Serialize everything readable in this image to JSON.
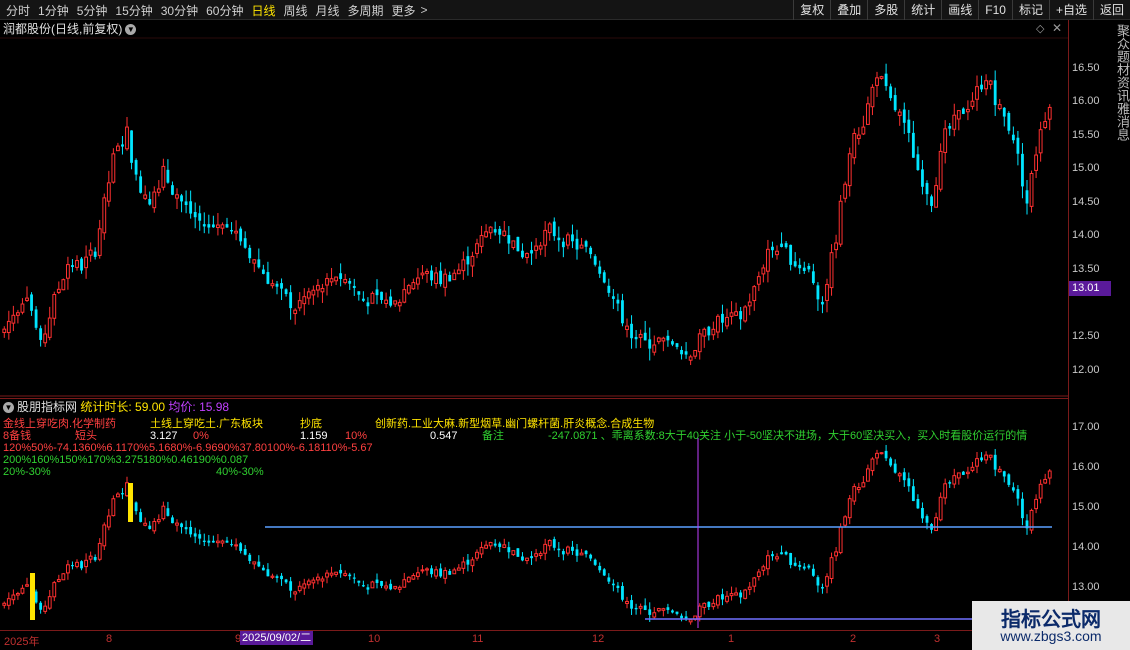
{
  "topbar": {
    "periods": [
      "分时",
      "1分钟",
      "5分钟",
      "15分钟",
      "30分钟",
      "60分钟",
      "日线",
      "周线",
      "月线",
      "多周期",
      "更多"
    ],
    "active_period": "日线",
    "tools": [
      "复权",
      "叠加",
      "多股",
      "统计",
      "画线",
      "F10",
      "标记",
      "+自选",
      "返回"
    ]
  },
  "main_chart": {
    "title": "润都股份(日线,前复权)",
    "y_ticks": [
      "16.50",
      "16.00",
      "15.50",
      "15.00",
      "14.50",
      "14.00",
      "13.50",
      "12.50",
      "12.00"
    ],
    "current_price": "13.01",
    "side_text": "聚众题材资讯雅消息"
  },
  "indicator": {
    "name": "股朋指标网",
    "duration_label": "统计时长: 59.00",
    "avg_label": "均价: 15.98",
    "y_ticks": [
      "17.00",
      "16.00",
      "15.00",
      "14.00",
      "13.00"
    ],
    "legend_rows": [
      [
        {
          "t": "金线上穿吃肉.化学制药",
          "c": "#ff4040"
        },
        {
          "t": "土线上穿吃土.广东板块",
          "c": "#ffe400"
        },
        {
          "t": "抄底",
          "c": "#ffe400"
        },
        {
          "t": "创新药.工业大麻.新型烟草.幽门螺杆菌.肝炎概念.合成生物",
          "c": "#ffe400"
        }
      ],
      [
        {
          "t": "8备钱",
          "c": "#ff4040"
        },
        {
          "t": "短头",
          "c": "#ff4040"
        },
        {
          "t": "3.127",
          "c": "#ffffff"
        },
        {
          "t": "0%",
          "c": "#ff4040"
        },
        {
          "t": "1.159",
          "c": "#ffffff"
        },
        {
          "t": "10%",
          "c": "#ff4040"
        },
        {
          "t": "0.547",
          "c": "#ffffff"
        },
        {
          "t": "备注",
          "c": "#30d030"
        },
        {
          "t": "-247.0871 、乖离系数:8大于40关注 小于-50坚决不进场，大于60坚决买入，买入时看股价运行的情",
          "c": "#30d030"
        }
      ],
      [
        {
          "t": "120%50%-74.1360%6.1170%5.1680%-6.9690%37.80100%-6.18110%-5.67",
          "c": "#ff4040"
        }
      ],
      [
        {
          "t": "200%160%150%170%3.275180%0.46190%0.087",
          "c": "#30d030"
        }
      ],
      [
        {
          "t": "20%-30%",
          "c": "#30d030"
        },
        {
          "t": "40%-30%",
          "c": "#30d030"
        }
      ]
    ]
  },
  "x_axis": {
    "labels": [
      "2025年",
      "8",
      "9",
      "10",
      "11",
      "12",
      "1",
      "2",
      "3"
    ],
    "cursor_date": "2025/09/02/二"
  },
  "watermark": {
    "line1": "指标公式网",
    "line2": "www.zbgs3.com"
  },
  "chart_data": {
    "type": "candlestick",
    "main_ylim": [
      11.8,
      16.9
    ],
    "indicator_ylim": [
      12.0,
      17.4
    ],
    "bull_color": "#ff3030",
    "bear_color": "#00e5ff",
    "close_path": [
      {
        "x": 0,
        "y": 12.62
      },
      {
        "x": 5,
        "y": 13.18
      },
      {
        "x": 8,
        "y": 12.35
      },
      {
        "x": 11,
        "y": 13.05
      },
      {
        "x": 14,
        "y": 13.6
      },
      {
        "x": 17,
        "y": 13.55
      },
      {
        "x": 20,
        "y": 13.8
      },
      {
        "x": 24,
        "y": 15.15
      },
      {
        "x": 27,
        "y": 15.55
      },
      {
        "x": 29,
        "y": 14.85
      },
      {
        "x": 32,
        "y": 14.55
      },
      {
        "x": 35,
        "y": 14.95
      },
      {
        "x": 38,
        "y": 14.6
      },
      {
        "x": 41,
        "y": 14.35
      },
      {
        "x": 45,
        "y": 14.1
      },
      {
        "x": 48,
        "y": 14.25
      },
      {
        "x": 52,
        "y": 13.95
      },
      {
        "x": 56,
        "y": 13.55
      },
      {
        "x": 60,
        "y": 13.2
      },
      {
        "x": 64,
        "y": 12.95
      },
      {
        "x": 67,
        "y": 13.15
      },
      {
        "x": 70,
        "y": 13.25
      },
      {
        "x": 73,
        "y": 13.45
      },
      {
        "x": 76,
        "y": 13.3
      },
      {
        "x": 79,
        "y": 13.05
      },
      {
        "x": 82,
        "y": 13.05
      },
      {
        "x": 86,
        "y": 13.0
      },
      {
        "x": 89,
        "y": 13.3
      },
      {
        "x": 92,
        "y": 13.45
      },
      {
        "x": 96,
        "y": 13.35
      },
      {
        "x": 100,
        "y": 13.5
      },
      {
        "x": 104,
        "y": 13.85
      },
      {
        "x": 107,
        "y": 14.15
      },
      {
        "x": 110,
        "y": 14.05
      },
      {
        "x": 114,
        "y": 13.75
      },
      {
        "x": 117,
        "y": 13.9
      },
      {
        "x": 120,
        "y": 14.1
      },
      {
        "x": 123,
        "y": 13.95
      },
      {
        "x": 126,
        "y": 13.85
      },
      {
        "x": 129,
        "y": 13.75
      },
      {
        "x": 132,
        "y": 13.4
      },
      {
        "x": 135,
        "y": 12.9
      },
      {
        "x": 138,
        "y": 12.55
      },
      {
        "x": 141,
        "y": 12.4
      },
      {
        "x": 144,
        "y": 12.45
      },
      {
        "x": 147,
        "y": 12.35
      },
      {
        "x": 150,
        "y": 12.15
      },
      {
        "x": 153,
        "y": 12.45
      },
      {
        "x": 156,
        "y": 12.7
      },
      {
        "x": 159,
        "y": 12.75
      },
      {
        "x": 162,
        "y": 12.8
      },
      {
        "x": 165,
        "y": 13.2
      },
      {
        "x": 168,
        "y": 13.8
      },
      {
        "x": 171,
        "y": 13.85
      },
      {
        "x": 174,
        "y": 13.6
      },
      {
        "x": 177,
        "y": 13.5
      },
      {
        "x": 180,
        "y": 13.0
      },
      {
        "x": 183,
        "y": 14.0
      },
      {
        "x": 186,
        "y": 15.3
      },
      {
        "x": 189,
        "y": 15.7
      },
      {
        "x": 192,
        "y": 16.45
      },
      {
        "x": 195,
        "y": 16.0
      },
      {
        "x": 198,
        "y": 15.7
      },
      {
        "x": 201,
        "y": 15.0
      },
      {
        "x": 204,
        "y": 14.55
      },
      {
        "x": 207,
        "y": 15.5
      },
      {
        "x": 210,
        "y": 15.8
      },
      {
        "x": 213,
        "y": 16.05
      },
      {
        "x": 216,
        "y": 16.4
      },
      {
        "x": 219,
        "y": 15.9
      },
      {
        "x": 222,
        "y": 15.5
      },
      {
        "x": 225,
        "y": 14.5
      },
      {
        "x": 228,
        "y": 15.65
      },
      {
        "x": 230,
        "y": 15.95
      }
    ]
  }
}
